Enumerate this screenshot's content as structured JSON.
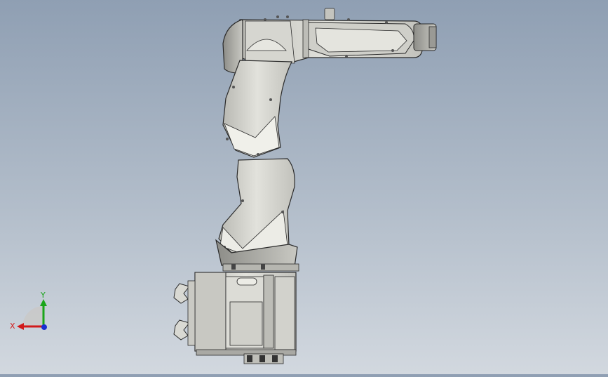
{
  "viewport": {
    "background_top": "#8f9fb3",
    "background_bottom": "#d2d8df",
    "model_fill": "#d9d9d3",
    "model_shade": "#a8a8a2",
    "model_edge": "#2a2a2a"
  },
  "triad": {
    "x_label": "X",
    "y_label": "Y",
    "x_color": "#d11a1a",
    "y_color": "#1aa51a",
    "z_color": "#1a2ed1"
  }
}
